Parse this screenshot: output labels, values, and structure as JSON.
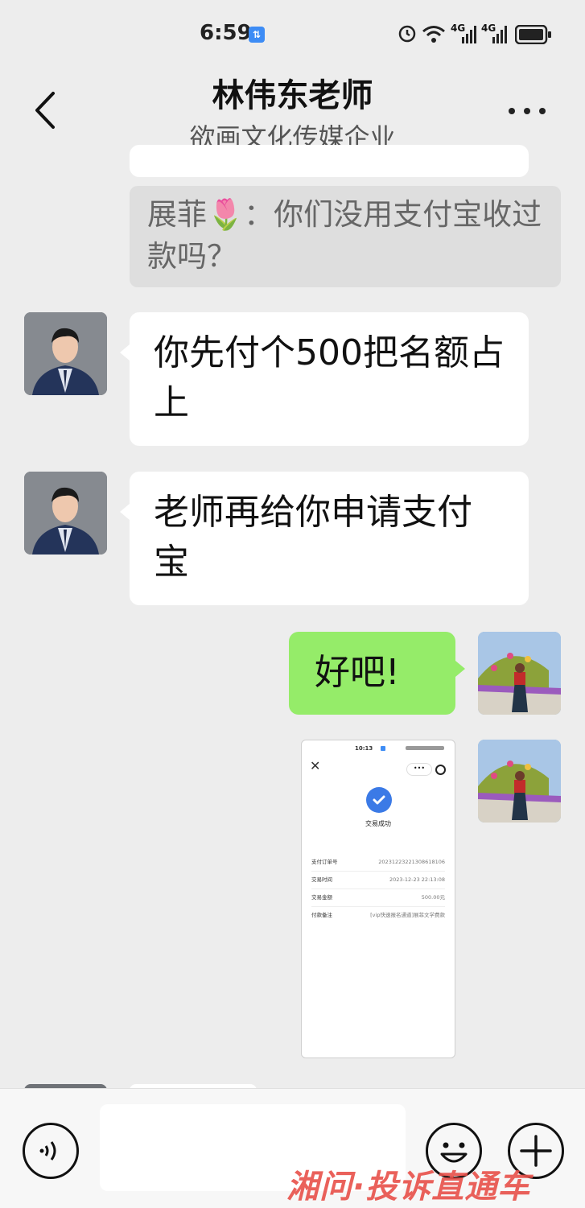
{
  "status_bar": {
    "time": "6:59",
    "badge": "⇅",
    "net1": "4G",
    "net2": "4G"
  },
  "header": {
    "title": "林伟东老师",
    "subtitle": "欲画文化传媒企业"
  },
  "messages": {
    "quote": "展菲🌷：你们没用支付宝收过款吗？",
    "m1": "你先付个500把名额占上",
    "m2": "老师再给你申请支付宝",
    "m3": "好吧!"
  },
  "shared_screenshot": {
    "time": "10:13",
    "status": "交易成功",
    "rows": [
      {
        "label": "支付订单号",
        "value": "20231223221308618106"
      },
      {
        "label": "交易时间",
        "value": "2023-12-23 22:13:08"
      },
      {
        "label": "交易金额",
        "value": "500.00元"
      },
      {
        "label": "付款备注",
        "value": "[vip快速报名通道]展菲文学费款"
      }
    ]
  },
  "watermark": "湘问·投诉直通车",
  "colors": {
    "bg": "#ededed",
    "bubble_self": "#95ec69",
    "bubble_other": "#ffffff",
    "accent": "#3d8cf5",
    "watermark": "#e8504a"
  }
}
